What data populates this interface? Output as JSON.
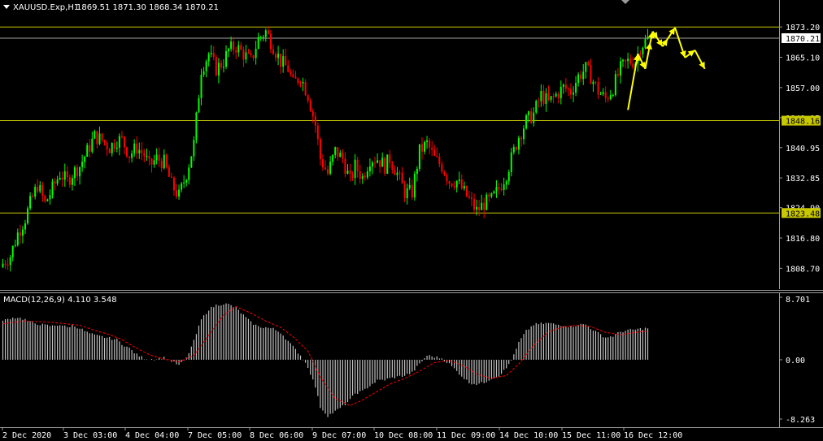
{
  "header": {
    "symbol_label": "XAUUSD.Exp,H1",
    "ohlc": "1869.51 1871.30 1868.34 1870.21"
  },
  "macd_header": "MACD(12,26,9) 4.110 3.548",
  "colors": {
    "background": "#000000",
    "bull": "#00ff00",
    "bear": "#ff0000",
    "level_line": "#c8c800",
    "current_line": "#a0a0a0",
    "forecast": "#ffff00",
    "macd_hist": "#c0c0c0",
    "macd_signal": "#ff0000"
  },
  "chart_data": [
    {
      "type": "candlestick",
      "ylim": [
        1804.0,
        1876.5
      ],
      "price_ticks": [
        "1873.20",
        "1865.10",
        "1857.00",
        "1848.95",
        "1840.95",
        "1832.85",
        "1824.90",
        "1816.80",
        "1808.70"
      ],
      "x_tick_labels": [
        "2 Dec 2020",
        "3 Dec 03:00",
        "4 Dec 04:00",
        "7 Dec 05:00",
        "8 Dec 06:00",
        "9 Dec 07:00",
        "10 Dec 08:00",
        "11 Dec 09:00",
        "14 Dec 10:00",
        "15 Dec 11:00",
        "16 Dec 12:00"
      ],
      "horizontal_levels": [
        {
          "price": 1873.2,
          "label": ""
        },
        {
          "price": 1848.16,
          "label": "1848.16"
        },
        {
          "price": 1823.48,
          "label": "1823.48"
        }
      ],
      "current_price": {
        "price": 1870.21,
        "label": "1870.21"
      },
      "close_path": [
        [
          0,
          1810
        ],
        [
          3,
          1812
        ],
        [
          6,
          1818
        ],
        [
          9,
          1822
        ],
        [
          11,
          1826
        ],
        [
          14,
          1831
        ],
        [
          17,
          1826
        ],
        [
          20,
          1830
        ],
        [
          23,
          1834
        ],
        [
          26,
          1832
        ],
        [
          28,
          1834
        ],
        [
          31,
          1836
        ],
        [
          34,
          1840
        ],
        [
          37,
          1844
        ],
        [
          40,
          1843
        ],
        [
          43,
          1841
        ],
        [
          46,
          1843
        ],
        [
          48,
          1843
        ],
        [
          51,
          1839
        ],
        [
          54,
          1841
        ],
        [
          57,
          1839
        ],
        [
          59,
          1836
        ],
        [
          62,
          1838
        ],
        [
          65,
          1837
        ],
        [
          68,
          1831
        ],
        [
          71,
          1828
        ],
        [
          74,
          1834
        ],
        [
          77,
          1842
        ],
        [
          80,
          1862
        ],
        [
          83,
          1866
        ],
        [
          86,
          1862
        ],
        [
          89,
          1864
        ],
        [
          91,
          1867
        ],
        [
          94,
          1868
        ],
        [
          97,
          1866
        ],
        [
          100,
          1864
        ],
        [
          103,
          1870
        ],
        [
          106,
          1872
        ],
        [
          109,
          1868
        ],
        [
          112,
          1864
        ],
        [
          115,
          1862
        ],
        [
          117,
          1858
        ],
        [
          120,
          1860
        ],
        [
          123,
          1855
        ],
        [
          126,
          1847
        ],
        [
          128,
          1838
        ],
        [
          131,
          1834
        ],
        [
          134,
          1840
        ],
        [
          137,
          1838
        ],
        [
          140,
          1832
        ],
        [
          142,
          1836
        ],
        [
          145,
          1833
        ],
        [
          148,
          1838
        ],
        [
          151,
          1838
        ],
        [
          154,
          1836
        ],
        [
          156,
          1838
        ],
        [
          159,
          1834
        ],
        [
          162,
          1829
        ],
        [
          165,
          1829
        ],
        [
          168,
          1840
        ],
        [
          171,
          1842
        ],
        [
          174,
          1838
        ],
        [
          177,
          1836
        ],
        [
          180,
          1832
        ],
        [
          183,
          1832
        ],
        [
          186,
          1829
        ],
        [
          188,
          1827
        ],
        [
          191,
          1824
        ],
        [
          194,
          1826
        ],
        [
          197,
          1827
        ],
        [
          200,
          1830
        ],
        [
          203,
          1834
        ],
        [
          206,
          1840
        ],
        [
          208,
          1844
        ],
        [
          211,
          1848
        ],
        [
          214,
          1850
        ],
        [
          217,
          1855
        ],
        [
          220,
          1853
        ],
        [
          223,
          1855
        ],
        [
          226,
          1857
        ],
        [
          229,
          1856
        ],
        [
          232,
          1860
        ],
        [
          235,
          1862
        ],
        [
          237,
          1860
        ],
        [
          240,
          1856
        ],
        [
          243,
          1854
        ],
        [
          246,
          1857
        ],
        [
          249,
          1862
        ],
        [
          252,
          1864
        ],
        [
          255,
          1864
        ],
        [
          257,
          1868
        ],
        [
          260,
          1870
        ]
      ],
      "forecast_path": [
        [
          252,
          1851
        ],
        [
          256,
          1866
        ],
        [
          259,
          1862
        ],
        [
          261,
          1869
        ],
        [
          262,
          1872
        ],
        [
          264,
          1870
        ],
        [
          266,
          1868
        ],
        [
          268,
          1870
        ],
        [
          271,
          1873
        ],
        [
          275,
          1865
        ],
        [
          279,
          1867
        ],
        [
          283,
          1862
        ]
      ]
    },
    {
      "type": "histogram",
      "title": "MACD(12,26,9) 4.110 3.548",
      "ylim": [
        -8.263,
        8.701
      ],
      "ticks": [
        "8.701",
        "0.00",
        "-8.263"
      ],
      "hist_path": [
        [
          0,
          5.4
        ],
        [
          3,
          5.8
        ],
        [
          6,
          5.9
        ],
        [
          9,
          5.6
        ],
        [
          11,
          5.2
        ],
        [
          14,
          5.0
        ],
        [
          17,
          4.8
        ],
        [
          20,
          4.7
        ],
        [
          23,
          4.9
        ],
        [
          26,
          4.5
        ],
        [
          28,
          4.8
        ],
        [
          31,
          4.4
        ],
        [
          34,
          3.8
        ],
        [
          37,
          3.4
        ],
        [
          40,
          3.2
        ],
        [
          43,
          3.0
        ],
        [
          46,
          2.8
        ],
        [
          48,
          2.2
        ],
        [
          51,
          1.6
        ],
        [
          54,
          0.7
        ],
        [
          57,
          0.2
        ],
        [
          59,
          0.1
        ],
        [
          62,
          0.1
        ],
        [
          65,
          0.3
        ],
        [
          68,
          -0.2
        ],
        [
          71,
          -0.8
        ],
        [
          74,
          0.2
        ],
        [
          77,
          2.6
        ],
        [
          80,
          5.6
        ],
        [
          83,
          7.0
        ],
        [
          86,
          7.6
        ],
        [
          89,
          7.8
        ],
        [
          91,
          7.7
        ],
        [
          94,
          7.2
        ],
        [
          97,
          6.2
        ],
        [
          100,
          5.2
        ],
        [
          103,
          4.6
        ],
        [
          106,
          4.5
        ],
        [
          109,
          4.3
        ],
        [
          112,
          3.8
        ],
        [
          115,
          2.6
        ],
        [
          117,
          1.8
        ],
        [
          120,
          0.6
        ],
        [
          123,
          -1.0
        ],
        [
          126,
          -3.8
        ],
        [
          128,
          -6.6
        ],
        [
          131,
          -7.8
        ],
        [
          134,
          -7.2
        ],
        [
          137,
          -6.5
        ],
        [
          140,
          -5.6
        ],
        [
          142,
          -4.7
        ],
        [
          145,
          -4.4
        ],
        [
          148,
          -3.6
        ],
        [
          151,
          -2.9
        ],
        [
          154,
          -2.8
        ],
        [
          156,
          -2.6
        ],
        [
          159,
          -2.4
        ],
        [
          162,
          -2.2
        ],
        [
          165,
          -1.8
        ],
        [
          168,
          -0.6
        ],
        [
          171,
          0.6
        ],
        [
          174,
          0.4
        ],
        [
          177,
          0.2
        ],
        [
          180,
          -0.6
        ],
        [
          183,
          -1.6
        ],
        [
          186,
          -2.6
        ],
        [
          188,
          -3.2
        ],
        [
          191,
          -3.4
        ],
        [
          194,
          -3.2
        ],
        [
          197,
          -2.6
        ],
        [
          200,
          -2.2
        ],
        [
          203,
          -1.2
        ],
        [
          206,
          0.6
        ],
        [
          208,
          2.4
        ],
        [
          211,
          4.0
        ],
        [
          214,
          4.9
        ],
        [
          217,
          5.0
        ],
        [
          220,
          5.1
        ],
        [
          223,
          4.9
        ],
        [
          226,
          4.8
        ],
        [
          229,
          4.6
        ],
        [
          232,
          4.9
        ],
        [
          235,
          4.9
        ],
        [
          237,
          4.4
        ],
        [
          240,
          3.7
        ],
        [
          243,
          3.1
        ],
        [
          246,
          3.3
        ],
        [
          249,
          3.9
        ],
        [
          252,
          4.1
        ],
        [
          255,
          4.2
        ],
        [
          257,
          4.3
        ],
        [
          260,
          4.4
        ]
      ],
      "signal_path": [
        [
          0,
          5.0
        ],
        [
          9,
          5.4
        ],
        [
          20,
          5.2
        ],
        [
          31,
          4.8
        ],
        [
          37,
          4.1
        ],
        [
          43,
          3.5
        ],
        [
          48,
          2.8
        ],
        [
          54,
          1.6
        ],
        [
          59,
          0.7
        ],
        [
          65,
          0.1
        ],
        [
          71,
          -0.3
        ],
        [
          77,
          0.6
        ],
        [
          83,
          3.4
        ],
        [
          89,
          6.2
        ],
        [
          94,
          7.4
        ],
        [
          100,
          6.5
        ],
        [
          106,
          5.4
        ],
        [
          112,
          4.5
        ],
        [
          117,
          3.2
        ],
        [
          123,
          1.2
        ],
        [
          128,
          -2.4
        ],
        [
          134,
          -5.4
        ],
        [
          140,
          -6.4
        ],
        [
          145,
          -5.6
        ],
        [
          151,
          -4.4
        ],
        [
          156,
          -3.4
        ],
        [
          162,
          -2.6
        ],
        [
          168,
          -1.6
        ],
        [
          174,
          -0.4
        ],
        [
          180,
          -0.1
        ],
        [
          186,
          -0.9
        ],
        [
          191,
          -2.0
        ],
        [
          197,
          -2.6
        ],
        [
          203,
          -2.2
        ],
        [
          208,
          -0.6
        ],
        [
          214,
          2.0
        ],
        [
          220,
          3.9
        ],
        [
          226,
          4.6
        ],
        [
          232,
          4.8
        ],
        [
          237,
          4.6
        ],
        [
          243,
          3.8
        ],
        [
          249,
          3.5
        ],
        [
          255,
          3.8
        ],
        [
          260,
          4.0
        ]
      ]
    }
  ]
}
